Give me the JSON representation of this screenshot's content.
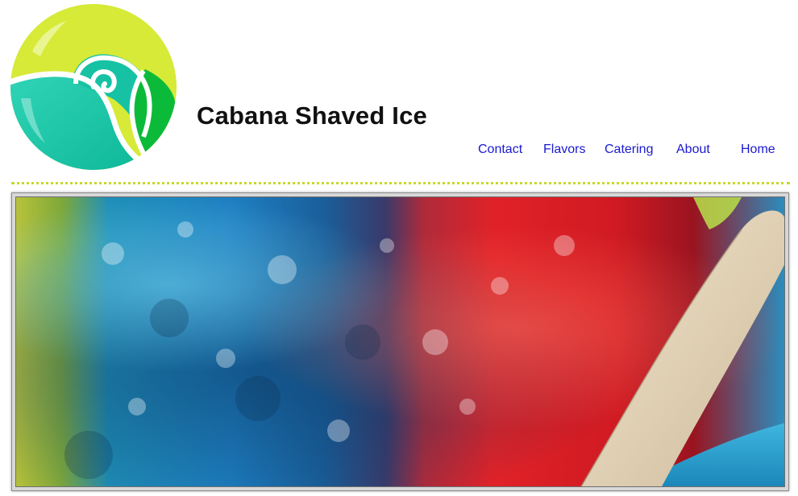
{
  "header": {
    "logo_name": "cabana-wave-logo",
    "title": "Cabana Shaved Ice"
  },
  "nav": {
    "items": [
      {
        "label": "Contact"
      },
      {
        "label": "Flavors"
      },
      {
        "label": "Catering"
      },
      {
        "label": "About"
      },
      {
        "label": "Home"
      }
    ]
  },
  "colors": {
    "brand_lime": "#d6ea37",
    "brand_teal": "#17c2a4",
    "brand_green": "#0cba3a",
    "nav_link": "#1a1ad0",
    "divider": "#c6d92a"
  },
  "hero": {
    "image_name": "rainbow-shaved-ice-photo"
  }
}
